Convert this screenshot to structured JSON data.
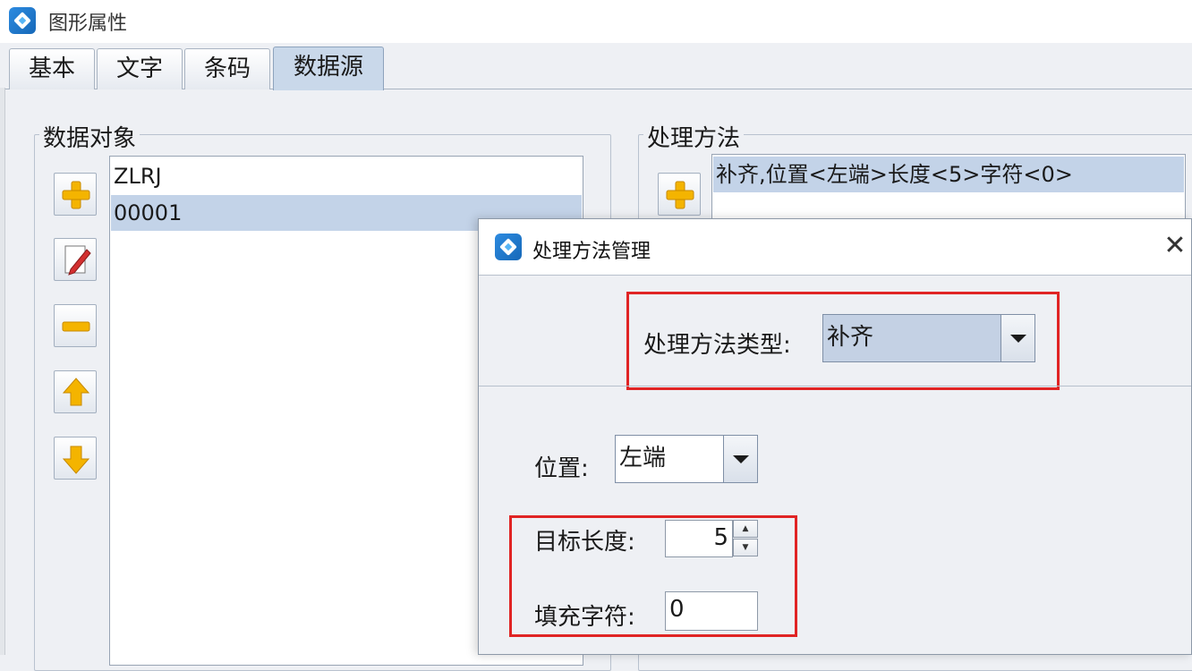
{
  "window": {
    "title": "图形属性",
    "icon": "app-logo-icon"
  },
  "tabs": [
    {
      "label": "基本"
    },
    {
      "label": "文字"
    },
    {
      "label": "条码"
    },
    {
      "label": "数据源",
      "active": true
    }
  ],
  "data_objects": {
    "legend": "数据对象",
    "items": [
      {
        "text": "ZLRJ",
        "selected": false
      },
      {
        "text": "00001",
        "selected": true
      }
    ],
    "buttons": [
      "add-icon",
      "edit-icon",
      "remove-icon",
      "move-up-icon",
      "move-down-icon"
    ]
  },
  "processing": {
    "legend": "处理方法",
    "items": [
      {
        "text": "补齐,位置<左端>长度<5>字符<0>",
        "selected": true
      }
    ],
    "buttons": [
      "add-icon"
    ]
  },
  "dialog": {
    "title": "处理方法管理",
    "close_glyph": "✕",
    "type_label": "处理方法类型:",
    "type_value": "补齐",
    "position_label": "位置:",
    "position_value": "左端",
    "target_length_label": "目标长度:",
    "target_length_value": "5",
    "fill_char_label": "填充字符:",
    "fill_char_value": "0"
  },
  "colors": {
    "highlight_red": "#e02424",
    "selection": "#c3d3e8",
    "icon_yellow": "#f4b400"
  }
}
